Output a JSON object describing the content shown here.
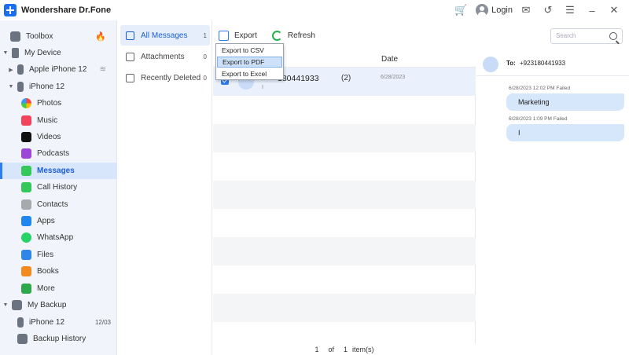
{
  "app": {
    "title": "Wondershare Dr.Fone"
  },
  "titlebar": {
    "login_label": "Login"
  },
  "sidebar": {
    "items": [
      {
        "label": "Toolbox"
      },
      {
        "label": "My Device"
      },
      {
        "label": "Apple iPhone 12"
      },
      {
        "label": "iPhone 12"
      },
      {
        "label": "Photos"
      },
      {
        "label": "Music"
      },
      {
        "label": "Videos"
      },
      {
        "label": "Podcasts"
      },
      {
        "label": "Messages"
      },
      {
        "label": "Call History"
      },
      {
        "label": "Contacts"
      },
      {
        "label": "Apps"
      },
      {
        "label": "WhatsApp"
      },
      {
        "label": "Files"
      },
      {
        "label": "Books"
      },
      {
        "label": "More"
      },
      {
        "label": "My Backup"
      },
      {
        "label": "iPhone 12",
        "badge": "12/03"
      },
      {
        "label": "Backup History"
      }
    ]
  },
  "categories": [
    {
      "label": "All Messages",
      "count": "1"
    },
    {
      "label": "Attachments",
      "count": "0"
    },
    {
      "label": "Recently Deleted",
      "count": "0"
    }
  ],
  "toolbar": {
    "export_label": "Export",
    "refresh_label": "Refresh",
    "search_placeholder": "Search"
  },
  "export_menu": {
    "items": [
      "Export to CSV",
      "Export to PDF",
      "Export to Excel"
    ],
    "highlighted": "Export to PDF"
  },
  "list": {
    "date_header": "Date",
    "rows": [
      {
        "name": "180441933",
        "count": "(2)",
        "date": "6/28/2023",
        "preview": "I",
        "checked": true
      }
    ]
  },
  "pagination": {
    "current": "1",
    "of_label": "of",
    "total": "1",
    "unit": "item(s)"
  },
  "conversation": {
    "to_label": "To:",
    "to_number": "+923180441933",
    "messages": [
      {
        "meta": "6/28/2023 12:02 PM Failed",
        "text": "Marketing"
      },
      {
        "meta": "6/28/2023 1:09 PM Failed",
        "text": "I"
      }
    ]
  },
  "colors": {
    "accent": "#2f7bf0",
    "active_bg": "#d8e6fb",
    "bubble": "#d6e6fb"
  }
}
